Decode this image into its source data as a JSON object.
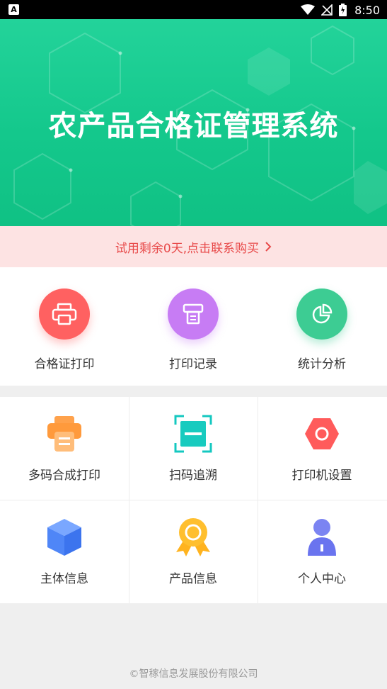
{
  "status": {
    "app_badge": "A",
    "time": "8:50"
  },
  "banner": {
    "title": "农产品合格证管理系统"
  },
  "trial": {
    "text": "试用剩余0天,点击联系购买"
  },
  "top_features": [
    {
      "label": "合格证打印",
      "icon": "printer-icon",
      "color": "#ff6161"
    },
    {
      "label": "打印记录",
      "icon": "print-record-icon",
      "color": "#c77cf4"
    },
    {
      "label": "统计分析",
      "icon": "pie-chart-icon",
      "color": "#3dcc93"
    }
  ],
  "grid": [
    {
      "label": "多码合成打印",
      "icon": "multi-code-print-icon"
    },
    {
      "label": "扫码追溯",
      "icon": "scan-trace-icon"
    },
    {
      "label": "打印机设置",
      "icon": "printer-settings-icon"
    },
    {
      "label": "主体信息",
      "icon": "entity-info-icon"
    },
    {
      "label": "产品信息",
      "icon": "product-info-icon"
    },
    {
      "label": "个人中心",
      "icon": "personal-center-icon"
    }
  ],
  "footer": {
    "text": "©智稼信息发展股份有限公司"
  }
}
